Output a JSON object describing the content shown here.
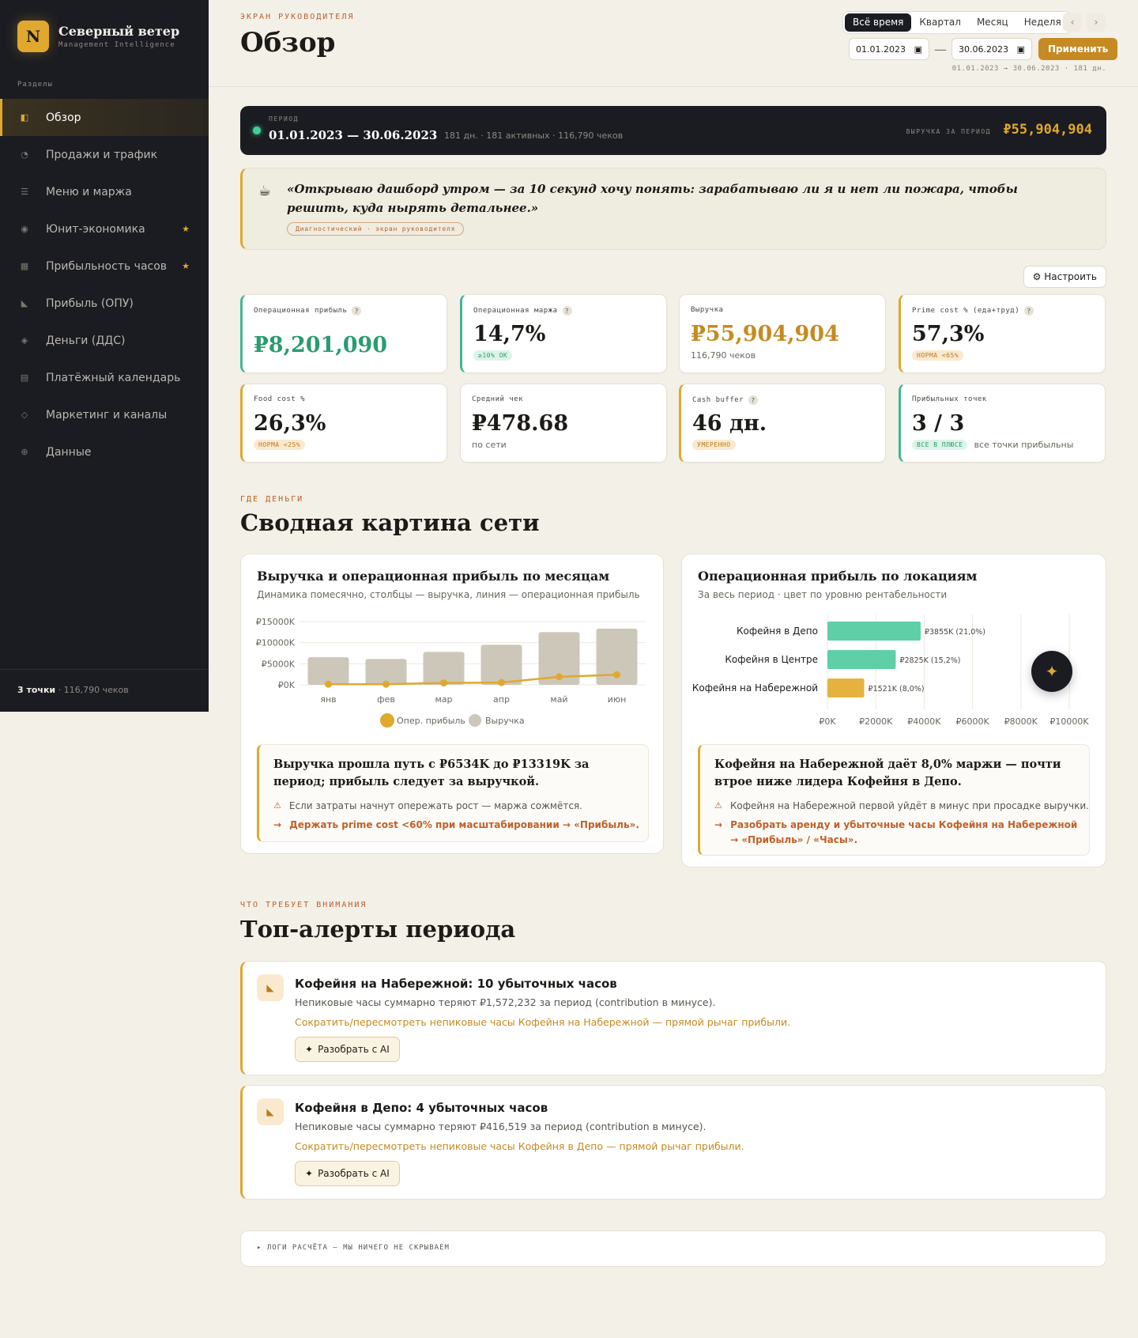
{
  "brand": {
    "logo_letter": "N",
    "title": "Северный ветер",
    "subtitle": "Management Intelligence"
  },
  "sidebar": {
    "section_label": "Разделы",
    "items": [
      {
        "label": "Обзор",
        "icon": "overview-icon",
        "glyph": "◧",
        "active": true,
        "starred": false
      },
      {
        "label": "Продажи и трафик",
        "icon": "pie-chart-icon",
        "glyph": "◔",
        "active": false,
        "starred": false
      },
      {
        "label": "Меню и маржа",
        "icon": "menu-icon",
        "glyph": "☰",
        "active": false,
        "starred": false
      },
      {
        "label": "Юнит-экономика",
        "icon": "target-icon",
        "glyph": "◉",
        "active": false,
        "starred": true
      },
      {
        "label": "Прибыльность часов",
        "icon": "grid-icon",
        "glyph": "▦",
        "active": false,
        "starred": true
      },
      {
        "label": "Прибыль (ОПУ)",
        "icon": "triangle-icon",
        "glyph": "◣",
        "active": false,
        "starred": false
      },
      {
        "label": "Деньги (ДДС)",
        "icon": "diamond-icon",
        "glyph": "◈",
        "active": false,
        "starred": false
      },
      {
        "label": "Платёжный календарь",
        "icon": "calendar-icon",
        "glyph": "▤",
        "active": false,
        "starred": false
      },
      {
        "label": "Маркетинг и каналы",
        "icon": "rhombus-icon",
        "glyph": "◇",
        "active": false,
        "starred": false
      },
      {
        "label": "Данные",
        "icon": "database-icon",
        "glyph": "⊕",
        "active": false,
        "starred": false
      }
    ],
    "star_glyph": "★",
    "footer_points": "3 точки",
    "footer_rest": " · 116,790 чеков"
  },
  "header": {
    "eyebrow": "Экран руководителя",
    "title": "Обзор",
    "periods": [
      "Всё время",
      "Квартал",
      "Месяц",
      "Неделя"
    ],
    "active_period": 0,
    "prev": "‹",
    "next": "›",
    "date_from": "01.01.2023",
    "date_to": "30.06.2023",
    "date_sep": "—",
    "apply_label": "Применить",
    "date_caption": "01.01.2023 → 30.06.2023 · 181 дн."
  },
  "period_bar": {
    "label": "ПЕРИОД",
    "range": "01.01.2023 — 30.06.2023",
    "meta": "181 дн. · 181 активных · 116,790 чеков",
    "revenue_label": "ВЫРУЧКА ЗА ПЕРИОД",
    "revenue_value": "₽55,904,904"
  },
  "quote": {
    "icon": "coffee-icon",
    "text": "«Открываю дашборд утром — за 10 секунд хочу понять: зарабатываю ли я и нет ли пожара, чтобы решить, куда нырять детальнее.»",
    "tag": "Диагностический · экран руководителя"
  },
  "configure_label": "⚙ Настроить",
  "kpis": [
    {
      "label": "Операционная прибыль",
      "help": true,
      "value": "₽8,201,090",
      "color": "#2a9b72",
      "border": "green",
      "badge": "",
      "badge_type": "",
      "sub": ""
    },
    {
      "label": "Операционная маржа",
      "help": true,
      "value": "14,7%",
      "color": "#1d1b18",
      "border": "green",
      "badge": "≥10% OK",
      "badge_type": "green",
      "sub": ""
    },
    {
      "label": "Выручка",
      "help": false,
      "value": "₽55,904,904",
      "color": "#c68a22",
      "border": "none",
      "badge": "",
      "badge_type": "",
      "sub": "116,790 чеков"
    },
    {
      "label": "Prime cost % (еда+труд)",
      "help": true,
      "value": "57,3%",
      "color": "#1d1b18",
      "border": "gold",
      "badge": "НОРМА <65%",
      "badge_type": "amber",
      "sub": ""
    },
    {
      "label": "Food cost %",
      "help": false,
      "value": "26,3%",
      "color": "#1d1b18",
      "border": "gold",
      "badge": "НОРМА <25%",
      "badge_type": "amber",
      "sub": ""
    },
    {
      "label": "Средний чек",
      "help": false,
      "value": "₽478.68",
      "color": "#1d1b18",
      "border": "none",
      "badge": "",
      "badge_type": "",
      "sub": "по сети"
    },
    {
      "label": "Cash buffer",
      "help": true,
      "value": "46 дн.",
      "color": "#1d1b18",
      "border": "gold",
      "badge": "УМЕРЕННО",
      "badge_type": "amber",
      "sub": ""
    },
    {
      "label": "Прибыльных точек",
      "help": false,
      "value": "3 / 3",
      "color": "#1d1b18",
      "border": "green",
      "badge": "ВСЕ В ПЛЮСЕ",
      "badge_type": "green",
      "sub": "все точки прибыльны"
    }
  ],
  "section1": {
    "eyebrow": "Где деньги",
    "title": "Сводная картина сети"
  },
  "chart_data": [
    {
      "type": "bar",
      "title": "Выручка и операционная прибыль по месяцам",
      "subtitle": "Динамика помесячно, столбцы — выручка, линия — операционная прибыль",
      "categories": [
        "янв",
        "фев",
        "мар",
        "апр",
        "май",
        "июн"
      ],
      "series": [
        {
          "name": "Выручка",
          "type": "bar",
          "color": "#cdc7ba",
          "values": [
            6534,
            6150,
            7800,
            9500,
            12500,
            13319
          ]
        },
        {
          "name": "Опер. прибыль",
          "type": "line",
          "color": "#e0a82e",
          "values": [
            150,
            150,
            450,
            550,
            1900,
            2400
          ]
        }
      ],
      "ylim": [
        0,
        15000
      ],
      "yticks": [
        0,
        5000,
        10000,
        15000
      ],
      "ytick_labels": [
        "₽0K",
        "₽5000K",
        "₽10000K",
        "₽15000K"
      ],
      "legend": "bottom"
    },
    {
      "type": "bar",
      "orientation": "horizontal",
      "title": "Операционная прибыль по локациям",
      "subtitle": "За весь период · цвет по уровню рентабельности",
      "categories": [
        "Кофейня в Депо",
        "Кофейня в Центре",
        "Кофейня на Набережной"
      ],
      "values": [
        3855,
        2825,
        1521
      ],
      "value_labels": [
        "₽3855K (21,0%)",
        "₽2825K (15,2%)",
        "₽1521K (8,0%)"
      ],
      "colors": [
        "#5fcfa8",
        "#5fcfa8",
        "#e6b23f"
      ],
      "xlim": [
        0,
        10000
      ],
      "xticks": [
        0,
        2000,
        4000,
        6000,
        8000,
        10000
      ],
      "xtick_labels": [
        "₽0K",
        "₽2000K",
        "₽4000K",
        "₽6000K",
        "₽8000K",
        "₽10000K"
      ]
    }
  ],
  "insights": [
    {
      "title": "Выручка прошла путь с ₽6534K до ₽13319K за период; прибыль следует за выручкой.",
      "warn": "Если затраты начнут опережать рост — маржа сожмётся.",
      "action": "Держать prime cost <60% при масштабировании → «Прибыль»."
    },
    {
      "title": "Кофейня на Набережной даёт 8,0% маржи — почти втрое ниже лидера Кофейня в Депо.",
      "warn": "Кофейня на Набережной первой уйдёт в минус при просадке выручки.",
      "action": "Разобрать аренду и убыточные часы Кофейня на Набережной → «Прибыль» / «Часы»."
    }
  ],
  "warn_glyph": "⚠",
  "arrow_glyph": "→",
  "ai_fab_glyph": "✦",
  "section2": {
    "eyebrow": "Что требует внимания",
    "title": "Топ-алерты периода"
  },
  "alerts": [
    {
      "title": "Кофейня на Набережной: 10 убыточных часов",
      "desc": "Непиковые часы суммарно теряют ₽1,572,232 за период (contribution в минусе).",
      "action": "Сократить/пересмотреть непиковые часы Кофейня на Набережной — прямой рычаг прибыли.",
      "button": "Разобрать с AI"
    },
    {
      "title": "Кофейня в Депо: 4 убыточных часов",
      "desc": "Непиковые часы суммарно теряют ₽416,519 за период (contribution в минусе).",
      "action": "Сократить/пересмотреть непиковые часы Кофейня в Депо — прямой рычаг прибыли.",
      "button": "Разобрать с AI"
    }
  ],
  "alert_glyph": "◣",
  "logs_label": "▸ ЛОГИ РАСЧЁТА — МЫ НИЧЕГО НЕ СКРЫВАЕМ"
}
